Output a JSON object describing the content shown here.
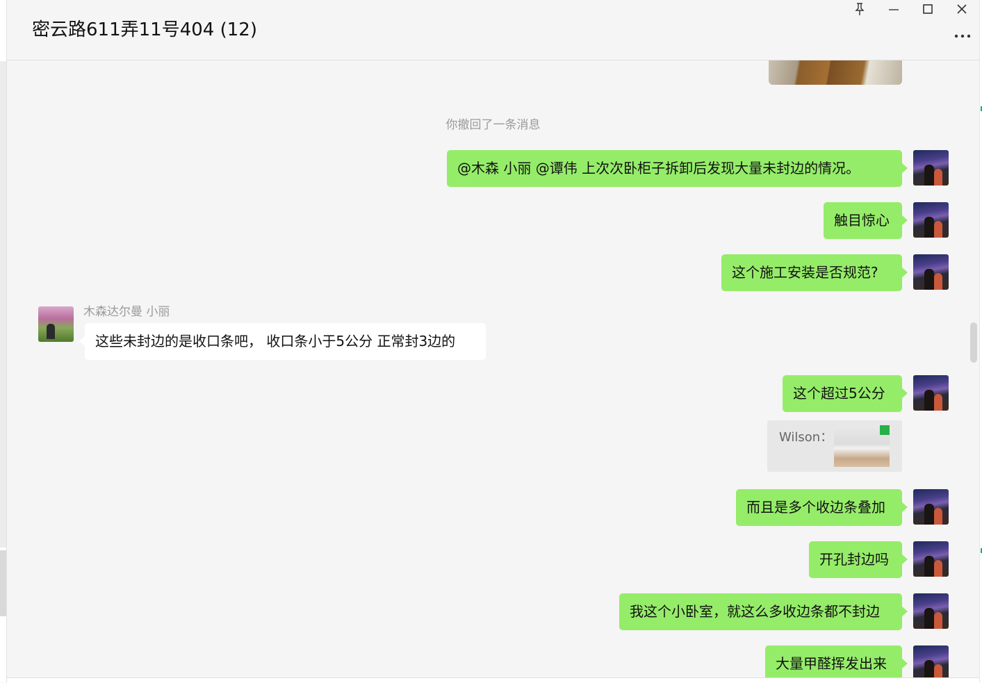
{
  "window": {
    "title": "密云路611弄11号404 (12)",
    "controls": {
      "pin": "pin-icon",
      "minimize": "minimize-icon",
      "maximize": "maximize-icon",
      "close": "close-icon",
      "more": "more-icon"
    }
  },
  "colors": {
    "my_bubble": "#95ec69",
    "other_bubble": "#ffffff",
    "background": "#f5f5f5",
    "system_text": "#9a9a9a"
  },
  "chat": {
    "system_notice": "你撤回了一条消息",
    "messages": [
      {
        "from": "me",
        "text": "@木森    小丽 @谭伟 上次次卧柜子拆卸后发现大量未封边的情况。"
      },
      {
        "from": "me",
        "text": "触目惊心"
      },
      {
        "from": "me",
        "text": "这个施工安装是否规范?"
      },
      {
        "from": "other",
        "sender": "木森达尔曼    小丽",
        "text": "这些未封边的是收口条吧，  收口条小于5公分 正常封3边的"
      },
      {
        "from": "me",
        "text": "这个超过5公分"
      },
      {
        "from": "me",
        "type": "quote",
        "quote_sender": "Wilson："
      },
      {
        "from": "me",
        "text": "而且是多个收边条叠加"
      },
      {
        "from": "me",
        "text": "开孔封边吗"
      },
      {
        "from": "me",
        "text": "我这个小卧室，就这么多收边条都不封边"
      },
      {
        "from": "me",
        "text": "大量甲醛挥发出来"
      }
    ]
  }
}
